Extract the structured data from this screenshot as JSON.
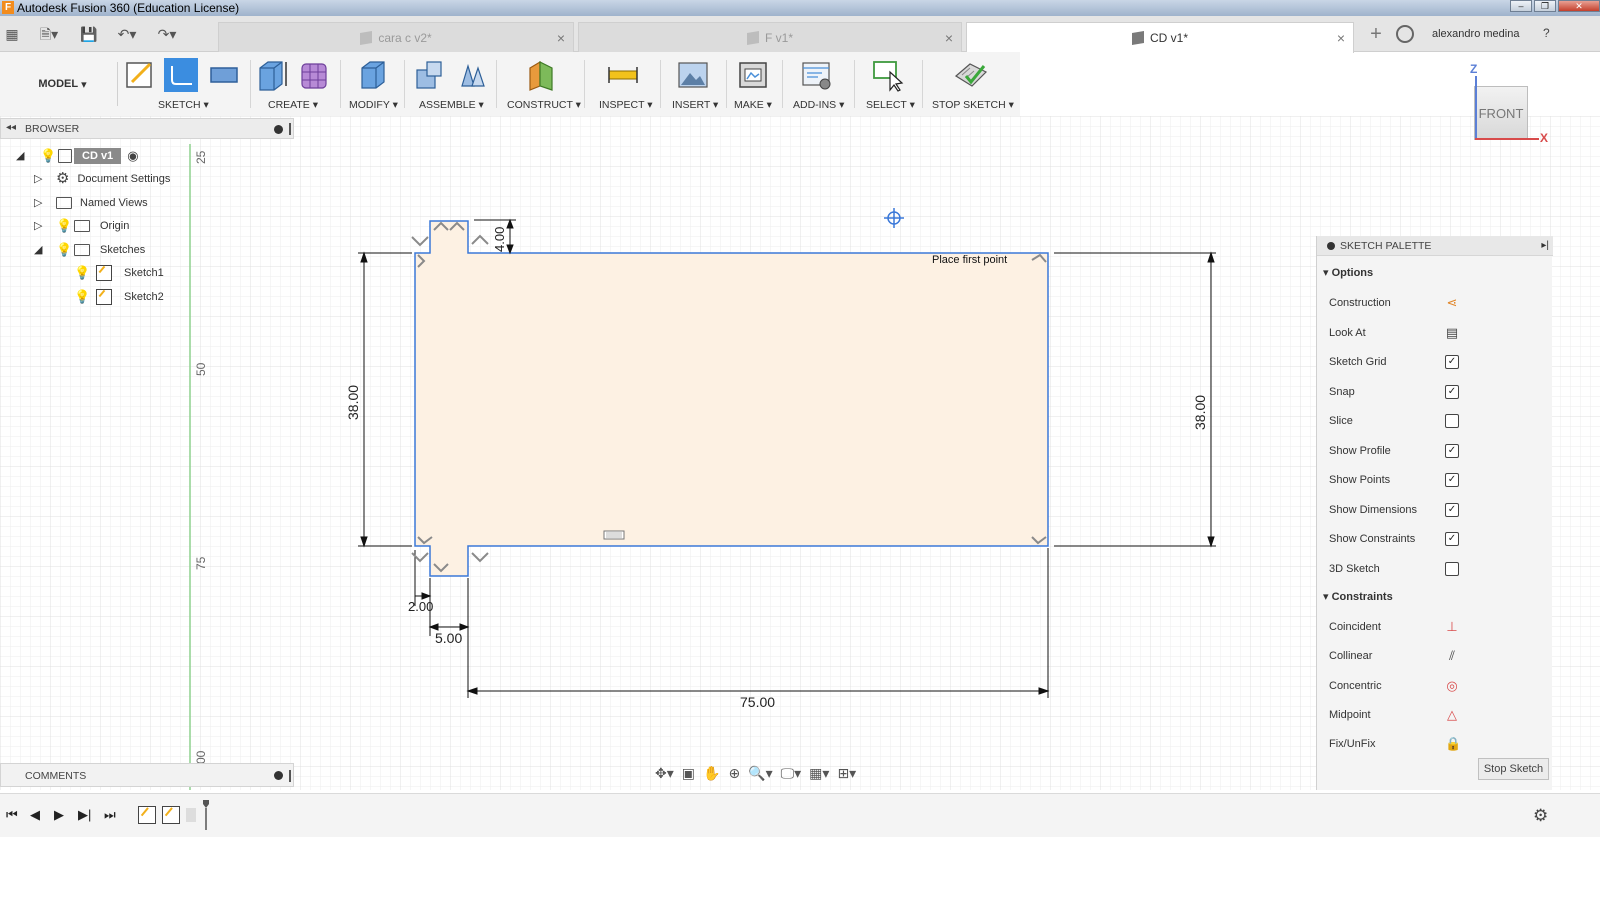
{
  "window": {
    "title": "Autodesk Fusion 360 (Education License)",
    "app_icon": "F"
  },
  "tabs": [
    {
      "label": "cara c v2*",
      "active": false
    },
    {
      "label": "F v1*",
      "active": false
    },
    {
      "label": "CD v1*",
      "active": true
    }
  ],
  "user": {
    "name": "alexandro medina"
  },
  "toolbar": {
    "workspace": "MODEL",
    "groups": [
      "SKETCH",
      "CREATE",
      "MODIFY",
      "ASSEMBLE",
      "CONSTRUCT",
      "INSPECT",
      "INSERT",
      "MAKE",
      "ADD-INS",
      "SELECT",
      "STOP SKETCH"
    ]
  },
  "browser": {
    "title": "BROWSER",
    "root": "CD v1",
    "items": [
      "Document Settings",
      "Named Views",
      "Origin",
      "Sketches",
      "Sketch1",
      "Sketch2"
    ]
  },
  "comments": {
    "title": "COMMENTS"
  },
  "canvas": {
    "hint": "Place first point",
    "ruler_labels": [
      "25",
      "50",
      "75",
      "00"
    ],
    "dimensions": [
      "38.00",
      "38.00",
      "4.00",
      "2.00",
      "5.00",
      "75.00"
    ],
    "viewcube_face": "FRONT",
    "axis_z": "Z",
    "axis_x": "X"
  },
  "palette": {
    "title": "SKETCH PALETTE",
    "options_title": "Options",
    "options": [
      {
        "name": "Construction",
        "type": "icon",
        "icon": "construction-icon"
      },
      {
        "name": "Look At",
        "type": "icon",
        "icon": "look-at-icon"
      },
      {
        "name": "Sketch Grid",
        "type": "check",
        "checked": true
      },
      {
        "name": "Snap",
        "type": "check",
        "checked": true
      },
      {
        "name": "Slice",
        "type": "check",
        "checked": false
      },
      {
        "name": "Show Profile",
        "type": "check",
        "checked": true
      },
      {
        "name": "Show Points",
        "type": "check",
        "checked": true
      },
      {
        "name": "Show Dimensions",
        "type": "check",
        "checked": true
      },
      {
        "name": "Show Constraints",
        "type": "check",
        "checked": true
      },
      {
        "name": "3D Sketch",
        "type": "check",
        "checked": false
      }
    ],
    "constraints_title": "Constraints",
    "constraints": [
      {
        "name": "Coincident",
        "icon": "coincident-icon"
      },
      {
        "name": "Collinear",
        "icon": "collinear-icon"
      },
      {
        "name": "Concentric",
        "icon": "concentric-icon"
      },
      {
        "name": "Midpoint",
        "icon": "midpoint-icon"
      },
      {
        "name": "Fix/UnFix",
        "icon": "lock-icon"
      }
    ],
    "stop_label": "Stop Sketch"
  },
  "colors": {
    "profile_fill": "#fdf1e3",
    "sketch_line": "#3b78d8",
    "accent": "#f28c1e"
  }
}
